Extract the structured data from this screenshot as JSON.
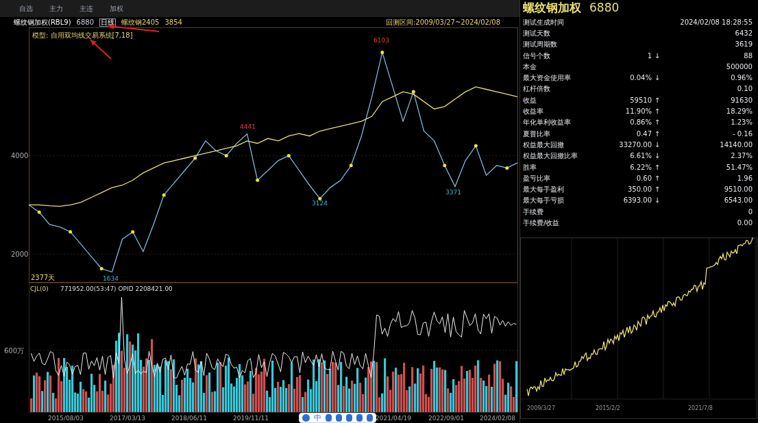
{
  "menu": [
    {
      "label": "自选"
    },
    {
      "label": "主力"
    },
    {
      "label": "主连"
    },
    {
      "label": "加权"
    }
  ],
  "header": {
    "symbol": "螺纹钢加权(RBL9)",
    "price": "6880",
    "period": "日线",
    "contract": "螺纹钢2405",
    "contract_price": "3854",
    "range": "回测区间:2009/03/27~2024/02/08"
  },
  "price_chart": {
    "model": "模型: 自用双均线交易系统[7,18]",
    "chart_data": {
      "type": "line",
      "ylim": [
        1430,
        6610
      ],
      "yticks": [
        {
          "value": 2000,
          "label": "2000"
        },
        {
          "value": 4000,
          "label": "4000"
        }
      ],
      "series": [
        {
          "color": "#7fb8d8",
          "values": [
            3000,
            2850,
            2600,
            2550,
            2450,
            2200,
            1950,
            1700,
            1634,
            2300,
            2450,
            2050,
            2600,
            3200,
            3450,
            3700,
            3950,
            4300,
            4100,
            4000,
            4250,
            4441,
            3500,
            3700,
            3900,
            4000,
            3700,
            3400,
            3124,
            3350,
            3500,
            3800,
            4400,
            5200,
            6103,
            5400,
            4700,
            5300,
            4500,
            4300,
            3800,
            3371,
            3900,
            4200,
            3600,
            3800,
            3750,
            3854
          ]
        },
        {
          "color": "#e8e070",
          "values": [
            3000,
            3000,
            2980,
            2970,
            3000,
            3050,
            3150,
            3250,
            3350,
            3400,
            3500,
            3650,
            3750,
            3850,
            3900,
            3950,
            4000,
            4050,
            4100,
            4150,
            4200,
            4300,
            4250,
            4350,
            4300,
            4400,
            4450,
            4400,
            4500,
            4550,
            4600,
            4650,
            4700,
            4800,
            5100,
            5200,
            5300,
            5250,
            5100,
            4950,
            5000,
            5150,
            5300,
            5400,
            5350,
            5300,
            5250,
            5200
          ]
        }
      ]
    },
    "markers": [
      {
        "text": "6103",
        "kind": "high"
      },
      {
        "text": "4441",
        "kind": "high"
      },
      {
        "text": "3124",
        "kind": "low"
      },
      {
        "text": "3371",
        "kind": "low"
      },
      {
        "text": "1634",
        "kind": "low"
      }
    ],
    "span": "2377天"
  },
  "volume_chart": {
    "name": "CJL(0)",
    "values": "771952.00(53:47)  OPID 2208421.00",
    "y_label": "600万",
    "x_labels": [
      "2015/08/03",
      "2017/03/13",
      "2018/06/11",
      "2019/11/11",
      "2021/04/19",
      "2022/09/01",
      "2024/02/08"
    ]
  },
  "ime_toolbar": {
    "mode": "中"
  },
  "stats": {
    "title": "螺纹钢加权",
    "price": "6880",
    "rows": [
      {
        "label": "测试生成时间",
        "value": "",
        "arrow": "",
        "total": "2024/02/08 18:28:55"
      },
      {
        "label": "测试天数",
        "value": "",
        "arrow": "",
        "total": "6432"
      },
      {
        "label": "测试周期数",
        "value": "",
        "arrow": "",
        "total": "3619"
      },
      {
        "label": "信号个数",
        "value": "1",
        "arrow": "↓",
        "total": "88"
      },
      {
        "label": "本金",
        "value": "",
        "arrow": "",
        "total": "500000"
      },
      {
        "label": "最大资金使用率",
        "value": "0.04%",
        "arrow": "↓",
        "total": "0.96%"
      },
      {
        "label": "杠杆倍数",
        "value": "",
        "arrow": "",
        "total": "0.10"
      },
      {
        "label": "收益",
        "value": "59510",
        "arrow": "↑",
        "total": "91630"
      },
      {
        "label": "收益率",
        "value": "11.90%",
        "arrow": "↑",
        "total": "18.29%"
      },
      {
        "label": "年化单利收益率",
        "value": "0.86%",
        "arrow": "↑",
        "total": "1.23%"
      },
      {
        "label": "夏普比率",
        "value": "0.47",
        "arrow": "↑",
        "total": "- 0.16"
      },
      {
        "label": "权益最大回撤",
        "value": "33270.00",
        "arrow": "↓",
        "total": "14140.00"
      },
      {
        "label": "权益最大回撤比率",
        "value": "6.61%",
        "arrow": "↓",
        "total": "2.37%"
      },
      {
        "label": "胜率",
        "value": "6.22%",
        "arrow": "↑",
        "total": "51.47%"
      },
      {
        "label": "盈亏比率",
        "value": "0.60",
        "arrow": "↑",
        "total": "1.96"
      },
      {
        "label": "最大每手盈利",
        "value": "350.00",
        "arrow": "↑",
        "total": "9510.00"
      },
      {
        "label": "最大每手亏损",
        "value": "6393.00",
        "arrow": "↓",
        "total": "6543.00"
      },
      {
        "label": "手续费",
        "value": "",
        "arrow": "",
        "total": "0"
      },
      {
        "label": "手续费/收益",
        "value": "",
        "arrow": "",
        "total": "0.00"
      }
    ]
  },
  "equity_chart": {
    "x_labels": [
      "2009/3/27",
      "2015/2/2",
      "2021/7/8"
    ]
  }
}
